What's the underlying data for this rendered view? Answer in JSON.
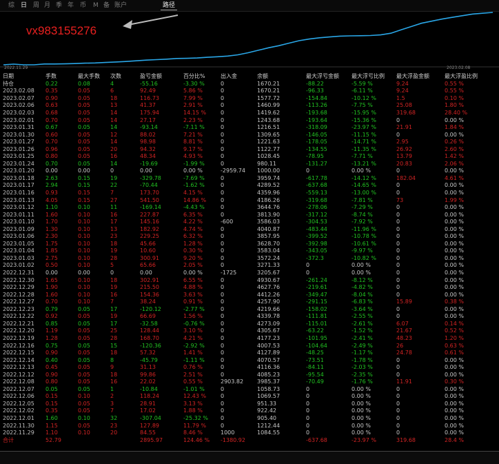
{
  "tabs": [
    "综",
    "日",
    "周",
    "月",
    "季",
    "年",
    "币",
    "M",
    "备",
    "账户"
  ],
  "tab_right": "路径",
  "watermark": "vx983155276",
  "chart": {
    "start_date": "2022.11.29",
    "end_date": "2023.02.08",
    "line_color": "#2aa7e8",
    "equity": [
      1000,
      1085,
      1000,
      1000,
      1100,
      1100,
      1120,
      1150,
      1200,
      1220,
      1280,
      1340,
      1400,
      1480,
      1560,
      1620,
      1680,
      1760,
      1780,
      1820,
      1900,
      1970,
      2050,
      2200,
      2450,
      2750,
      3050,
      3300,
      3600,
      3900,
      4100,
      4250,
      4350,
      4450,
      4480,
      4500,
      4520,
      4600,
      4800,
      5200,
      5600,
      6000,
      6250,
      6500,
      6700,
      6900,
      7100,
      7200,
      7300
    ]
  },
  "columns": [
    "日期",
    "手数",
    "最大手数",
    "次数",
    "盈亏金额",
    "百分比%",
    "出入金",
    "余额",
    "最大浮亏金额",
    "最大浮亏比例",
    "最大浮盈金额",
    "最大浮盈比例"
  ],
  "holding": {
    "label": "持仓",
    "lots": "0.22",
    "max_lots": "0.08",
    "count": "4",
    "pnl": "-55.16",
    "pct": "-3.30 %",
    "flow": "0",
    "balance": "1670.21",
    "max_fl": "-88.22",
    "max_fl_pct": "-5.59 %",
    "max_fp": "9.24",
    "max_fp_pct": "0.55 %"
  },
  "rows": [
    [
      "2023.02.08",
      "0.35",
      "0.05",
      "6",
      "92.49",
      "5.86 %",
      "0",
      "1670.21",
      "-96.33",
      "-6.11 %",
      "9.24",
      "0.55 %"
    ],
    [
      "2023.02.07",
      "0.90",
      "0.05",
      "18",
      "116.73",
      "7.99 %",
      "0",
      "1577.72",
      "-154.84",
      "-10.12 %",
      "1.5",
      "0.10 %"
    ],
    [
      "2023.02.06",
      "0.63",
      "0.05",
      "13",
      "41.37",
      "2.91 %",
      "0",
      "1460.99",
      "-113.26",
      "-7.75 %",
      "25.08",
      "1.80 %"
    ],
    [
      "2023.02.03",
      "0.68",
      "0.05",
      "14",
      "175.94",
      "14.15 %",
      "0",
      "1419.62",
      "-193.68",
      "-15.95 %",
      "319.68",
      "28.40 %"
    ],
    [
      "2023.02.01",
      "0.70",
      "0.05",
      "14",
      "27.17",
      "2.23 %",
      "0",
      "1243.68",
      "-193.64",
      "-15.36 %",
      "0",
      "0.00 %"
    ],
    [
      "2023.01.31",
      "0.67",
      "0.05",
      "14",
      "-93.14",
      "-7.11 %",
      "0",
      "1216.51",
      "-318.09",
      "-23.97 %",
      "21.91",
      "1.84 %"
    ],
    [
      "2023.01.30",
      "0.60",
      "0.05",
      "12",
      "88.02",
      "7.21 %",
      "0",
      "1309.65",
      "-146.05",
      "-11.15 %",
      "0",
      "0.00 %"
    ],
    [
      "2023.01.27",
      "0.70",
      "0.05",
      "14",
      "98.98",
      "8.81 %",
      "0",
      "1221.63",
      "-178.05",
      "-14.71 %",
      "2.95",
      "0.26 %"
    ],
    [
      "2023.01.26",
      "0.96",
      "0.05",
      "20",
      "94.32",
      "9.17 %",
      "0",
      "1122.77",
      "-134.55",
      "-11.35 %",
      "26.92",
      "2.60 %"
    ],
    [
      "2023.01.25",
      "0.80",
      "0.05",
      "16",
      "48.34",
      "4.93 %",
      "0",
      "1028.45",
      "-78.95",
      "-7.71 %",
      "13.79",
      "1.42 %"
    ],
    [
      "2023.01.24",
      "0.70",
      "0.05",
      "14",
      "-19.69",
      "-1.99 %",
      "0",
      "980.11",
      "-131.27",
      "-13.21 %",
      "20.83",
      "2.06 %"
    ],
    [
      "2023.01.20",
      "0.00",
      "0.00",
      "0",
      "0.00",
      "0.00 %",
      "-2959.74",
      "1000.00",
      "0",
      "0.00 %",
      "0",
      "0.00 %"
    ],
    [
      "2023.01.18",
      "2.63",
      "0.15",
      "19",
      "-329.78",
      "-7.69 %",
      "0",
      "3959.74",
      "-617.78",
      "-14.12 %",
      "182.04",
      "4.61 %"
    ],
    [
      "2023.01.17",
      "2.94",
      "0.15",
      "22",
      "-70.44",
      "-1.62 %",
      "0",
      "4289.52",
      "-637.68",
      "-14.65 %",
      "0",
      "0.00 %"
    ],
    [
      "2023.01.16",
      "0.93",
      "0.15",
      "7",
      "173.70",
      "4.15 %",
      "0",
      "4359.96",
      "-559.13",
      "-13.00 %",
      "0",
      "0.00 %"
    ],
    [
      "2023.01.13",
      "4.05",
      "0.15",
      "27",
      "541.50",
      "14.86 %",
      "0",
      "4186.26",
      "-319.68",
      "-7.81 %",
      "73",
      "1.99 %"
    ],
    [
      "2023.01.12",
      "1.10",
      "0.10",
      "11",
      "-169.14",
      "-4.43 %",
      "0",
      "3644.76",
      "-278.06",
      "-7.29 %",
      "0",
      "0.00 %"
    ],
    [
      "2023.01.11",
      "1.60",
      "0.10",
      "16",
      "227.87",
      "6.35 %",
      "0",
      "3813.90",
      "-317.12",
      "-8.74 %",
      "0",
      "0.00 %"
    ],
    [
      "2023.01.10",
      "1.70",
      "0.10",
      "17",
      "145.16",
      "4.22 %",
      "-600",
      "3586.03",
      "-304.53",
      "-7.92 %",
      "0",
      "0.00 %"
    ],
    [
      "2023.01.09",
      "1.30",
      "0.10",
      "13",
      "182.92",
      "4.74 %",
      "0",
      "4040.87",
      "-483.44",
      "-11.96 %",
      "0",
      "0.00 %"
    ],
    [
      "2023.01.06",
      "2.30",
      "0.10",
      "23",
      "229.25",
      "6.32 %",
      "0",
      "3857.95",
      "-399.52",
      "-10.78 %",
      "0",
      "0.00 %"
    ],
    [
      "2023.01.05",
      "1.75",
      "0.10",
      "18",
      "45.66",
      "1.28 %",
      "0",
      "3628.70",
      "-392.98",
      "-10.61 %",
      "0",
      "0.00 %"
    ],
    [
      "2023.01.04",
      "1.85",
      "0.10",
      "19",
      "10.60",
      "0.30 %",
      "0",
      "3583.04",
      "-343.05",
      "-9.97 %",
      "0",
      "0.00 %"
    ],
    [
      "2023.01.03",
      "2.75",
      "0.10",
      "28",
      "300.91",
      "9.20 %",
      "0",
      "3572.24",
      "-372.3",
      "-10.82 %",
      "0",
      "0.00 %"
    ],
    [
      "2023.01.02",
      "0.50",
      "0.10",
      "5",
      "65.66",
      "2.05 %",
      "0",
      "3271.33",
      "0",
      "0.00 %",
      "0",
      "0.00 %"
    ],
    [
      "2022.12.31",
      "0.00",
      "0.00",
      "0",
      "0.00",
      "0.00 %",
      "-1725",
      "3205.67",
      "0",
      "0.00 %",
      "0",
      "0.00 %"
    ],
    [
      "2022.12.30",
      "1.65",
      "0.10",
      "18",
      "302.91",
      "6.55 %",
      "0",
      "4930.67",
      "-261.24",
      "-8.12 %",
      "0",
      "0.00 %"
    ],
    [
      "2022.12.29",
      "1.90",
      "0.10",
      "19",
      "215.50",
      "4.88 %",
      "0",
      "4627.76",
      "-219.61",
      "-4.82 %",
      "0",
      "0.00 %"
    ],
    [
      "2022.12.28",
      "1.60",
      "0.10",
      "16",
      "154.36",
      "3.63 %",
      "0",
      "4412.26",
      "-349.47",
      "-8.04 %",
      "0",
      "0.00 %"
    ],
    [
      "2022.12.27",
      "0.70",
      "0.10",
      "7",
      "38.24",
      "0.91 %",
      "0",
      "4257.90",
      "-291.15",
      "-6.83 %",
      "15.89",
      "0.38 %"
    ],
    [
      "2022.12.23",
      "0.79",
      "0.05",
      "17",
      "-120.12",
      "-2.77 %",
      "0",
      "4219.66",
      "-158.02",
      "-3.64 %",
      "0",
      "0.00 %"
    ],
    [
      "2022.12.22",
      "0.92",
      "0.05",
      "19",
      "66.69",
      "1.56 %",
      "0",
      "4339.78",
      "-111.81",
      "-2.55 %",
      "0",
      "0.00 %"
    ],
    [
      "2022.12.21",
      "0.85",
      "0.05",
      "17",
      "-32.58",
      "-0.76 %",
      "0",
      "4273.09",
      "-115.01",
      "-2.61 %",
      "6.07",
      "0.14 %"
    ],
    [
      "2022.12.20",
      "1.19",
      "0.05",
      "25",
      "128.44",
      "3.10 %",
      "0",
      "4305.67",
      "-63.22",
      "-1.52 %",
      "21.67",
      "0.52 %"
    ],
    [
      "2022.12.19",
      "1.28",
      "0.05",
      "28",
      "168.70",
      "4.21 %",
      "0",
      "4177.23",
      "-101.95",
      "-2.41 %",
      "48.23",
      "1.20 %"
    ],
    [
      "2022.12.16",
      "0.75",
      "0.05",
      "15",
      "-120.36",
      "-2.92 %",
      "0",
      "4007.53",
      "-104.64",
      "-2.49 %",
      "26",
      "0.63 %"
    ],
    [
      "2022.12.15",
      "0.90",
      "0.05",
      "18",
      "57.32",
      "1.41 %",
      "0",
      "4127.89",
      "-48.25",
      "-1.17 %",
      "24.78",
      "0.61 %"
    ],
    [
      "2022.12.14",
      "0.40",
      "0.05",
      "8",
      "-45.79",
      "-1.11 %",
      "0",
      "4070.57",
      "-73.51",
      "-1.78 %",
      "0",
      "0.00 %"
    ],
    [
      "2022.12.13",
      "0.45",
      "0.05",
      "9",
      "31.13",
      "0.76 %",
      "0",
      "4116.36",
      "-84.11",
      "-2.03 %",
      "0",
      "0.00 %"
    ],
    [
      "2022.12.12",
      "0.90",
      "0.05",
      "18",
      "99.86",
      "2.51 %",
      "0",
      "4085.23",
      "-95.54",
      "-2.35 %",
      "0",
      "0.00 %"
    ],
    [
      "2022.12.08",
      "0.80",
      "0.05",
      "16",
      "22.02",
      "0.55 %",
      "2903.82",
      "3985.37",
      "-70.49",
      "-1.76 %",
      "11.91",
      "0.30 %"
    ],
    [
      "2022.12.07",
      "0.05",
      "0.05",
      "1",
      "-10.84",
      "-1.01 %",
      "0",
      "1058.73",
      "0",
      "0.00 %",
      "0",
      "0.00 %"
    ],
    [
      "2022.12.06",
      "0.15",
      "0.10",
      "2",
      "118.24",
      "12.43 %",
      "0",
      "1069.57",
      "0",
      "0.00 %",
      "0",
      "0.00 %"
    ],
    [
      "2022.12.05",
      "0.15",
      "0.05",
      "3",
      "28.91",
      "3.13 %",
      "0",
      "951.33",
      "0",
      "0.00 %",
      "0",
      "0.00 %"
    ],
    [
      "2022.12.02",
      "0.35",
      "0.05",
      "7",
      "17.02",
      "1.88 %",
      "0",
      "922.42",
      "0",
      "0.00 %",
      "0",
      "0.00 %"
    ],
    [
      "2022.12.01",
      "1.60",
      "0.10",
      "32",
      "-307.04",
      "-25.32 %",
      "0",
      "905.40",
      "0",
      "0.00 %",
      "0",
      "0.00 %"
    ],
    [
      "2022.11.30",
      "1.15",
      "0.05",
      "23",
      "127.89",
      "11.79 %",
      "0",
      "1212.44",
      "0",
      "0.00 %",
      "0",
      "0.00 %"
    ],
    [
      "2022.11.29",
      "1.10",
      "0.10",
      "20",
      "84.55",
      "8.46 %",
      "1000",
      "1084.55",
      "0",
      "0.00 %",
      "0",
      "0.00 %"
    ]
  ],
  "total": {
    "label": "合计",
    "lots": "52.79",
    "pnl": "2895.97",
    "pct": "124.46 %",
    "flow": "-1380.92",
    "max_fl": "-637.68",
    "max_fl_pct": "-23.97 %",
    "max_fp": "319.68",
    "max_fp_pct": "28.4 %"
  }
}
